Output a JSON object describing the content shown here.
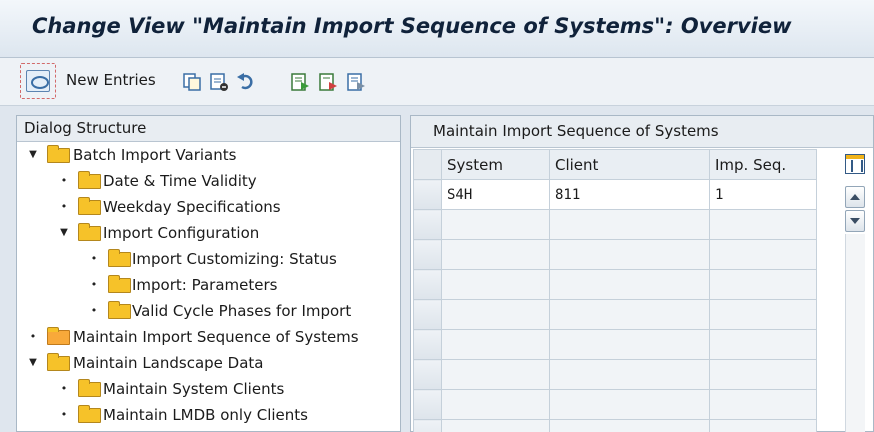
{
  "title": "Change View \"Maintain Import Sequence of Systems\": Overview",
  "toolbar": {
    "new_entries_label": "New Entries",
    "icons": [
      "select-mode-icon",
      "copy-icon",
      "delete-icon",
      "undo-icon",
      "select-all-icon",
      "select-block-icon",
      "deselect-all-icon"
    ]
  },
  "dialog_structure": {
    "header": "Dialog Structure",
    "items": [
      {
        "label": "Batch Import Variants",
        "level": 0,
        "expanded": true
      },
      {
        "label": "Date & Time Validity",
        "level": 1
      },
      {
        "label": "Weekday Specifications",
        "level": 1
      },
      {
        "label": "Import Configuration",
        "level": 1,
        "expanded": true
      },
      {
        "label": "Import Customizing: Status",
        "level": 2
      },
      {
        "label": "Import: Parameters",
        "level": 2
      },
      {
        "label": "Valid Cycle Phases for Import",
        "level": 2
      },
      {
        "label": "Maintain Import Sequence of Systems",
        "level": 0,
        "selected": true
      },
      {
        "label": "Maintain Landscape Data",
        "level": 0,
        "expanded": true
      },
      {
        "label": "Maintain System Clients",
        "level": 1
      },
      {
        "label": "Maintain LMDB only Clients",
        "level": 1
      }
    ]
  },
  "table": {
    "header": "Maintain Import Sequence of Systems",
    "columns": [
      "System",
      "Client",
      "Imp. Seq."
    ],
    "rows": [
      [
        "S4H",
        "811",
        "1"
      ]
    ]
  },
  "colors": {
    "highlight_border": "#e04747",
    "highlight_fill": "#fcf3c4",
    "folder": "#f6c229"
  }
}
